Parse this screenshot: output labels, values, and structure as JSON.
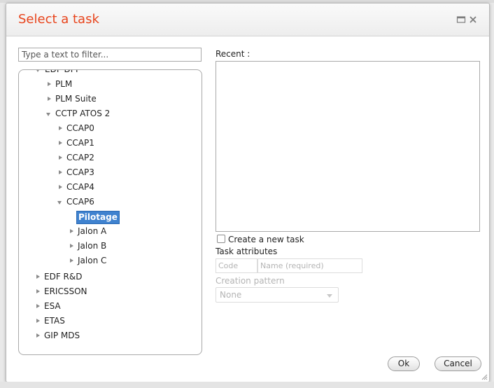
{
  "dialog": {
    "title": "Select a task"
  },
  "filter": {
    "placeholder": "Type a text to filter..."
  },
  "tree": {
    "items": [
      {
        "label": "EDF DPI",
        "state": "expanded",
        "level": 1
      },
      {
        "label": "PLM",
        "state": "collapsed",
        "level": 2
      },
      {
        "label": "PLM Suite",
        "state": "collapsed",
        "level": 2
      },
      {
        "label": "CCTP ATOS 2",
        "state": "expanded",
        "level": 2
      },
      {
        "label": "CCAP0",
        "state": "collapsed",
        "level": 3
      },
      {
        "label": "CCAP1",
        "state": "collapsed",
        "level": 3
      },
      {
        "label": "CCAP2",
        "state": "collapsed",
        "level": 3
      },
      {
        "label": "CCAP3",
        "state": "collapsed",
        "level": 3
      },
      {
        "label": "CCAP4",
        "state": "collapsed",
        "level": 3
      },
      {
        "label": "CCAP6",
        "state": "expanded",
        "level": 3
      },
      {
        "label": "Pilotage",
        "state": "leaf",
        "level": 4,
        "selected": true
      },
      {
        "label": "Jalon A",
        "state": "collapsed",
        "level": 4
      },
      {
        "label": "Jalon B",
        "state": "collapsed",
        "level": 4
      },
      {
        "label": "Jalon C",
        "state": "collapsed",
        "level": 4
      },
      {
        "label": "EDF R&D",
        "state": "collapsed",
        "level": 1
      },
      {
        "label": "ERICSSON",
        "state": "collapsed",
        "level": 1
      },
      {
        "label": "ESA",
        "state": "collapsed",
        "level": 1
      },
      {
        "label": "ETAS",
        "state": "collapsed",
        "level": 1
      },
      {
        "label": "GIP MDS",
        "state": "collapsed",
        "level": 1
      }
    ]
  },
  "recent": {
    "label": "Recent :"
  },
  "new_task": {
    "checkbox_label": "Create a new task",
    "checked": false,
    "attributes_label": "Task attributes",
    "code_placeholder": "Code",
    "name_placeholder": "Name (required)",
    "pattern_label": "Creation pattern",
    "pattern_value": "None"
  },
  "buttons": {
    "ok": "Ok",
    "cancel": "Cancel"
  },
  "colors": {
    "title": "#e8441c",
    "selection": "#3f82cf"
  }
}
